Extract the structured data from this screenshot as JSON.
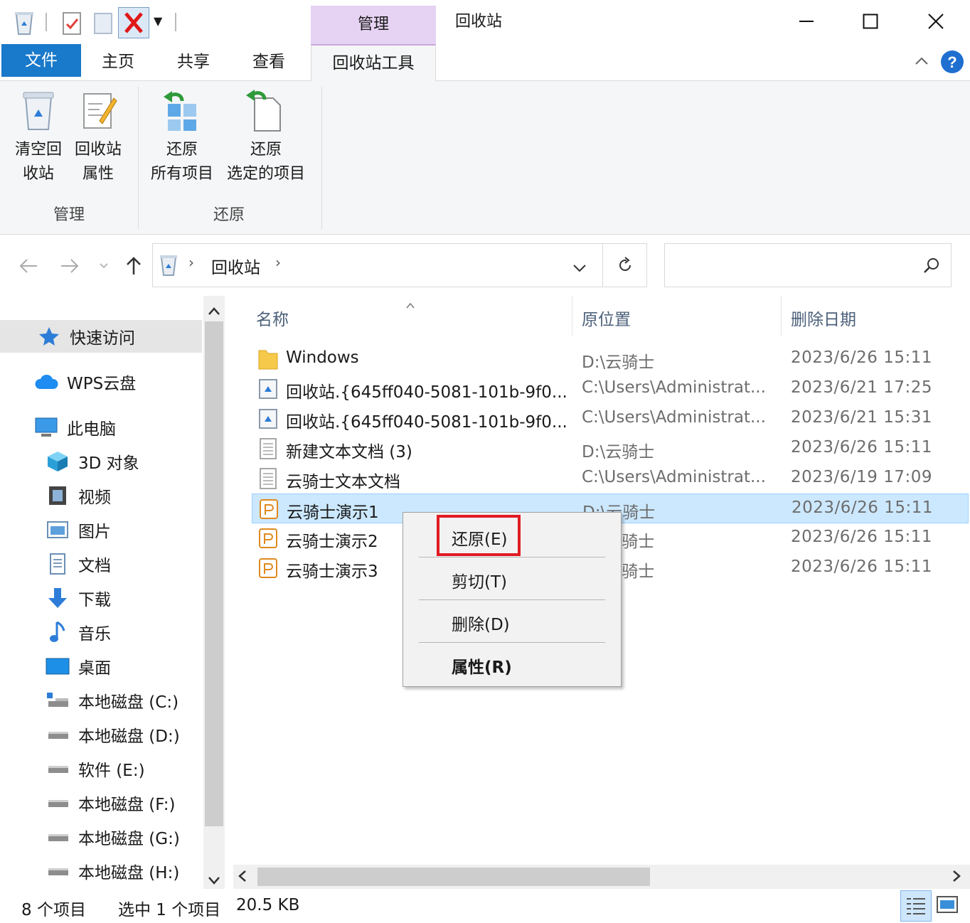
{
  "window": {
    "title": "回收站",
    "context_tab_header": "管理",
    "minimize_glyph": "—",
    "maximize_glyph": "☐",
    "close_glyph": "✕"
  },
  "ribbon_tabs": [
    "文件",
    "主页",
    "共享",
    "查看",
    "回收站工具"
  ],
  "ribbon": {
    "groups": [
      {
        "label": "管理",
        "buttons": [
          {
            "line1": "清空回",
            "line2": "收站",
            "icon": "empty-recycle-bin-icon"
          },
          {
            "line1": "回收站",
            "line2": "属性",
            "icon": "recycle-bin-properties-icon"
          }
        ]
      },
      {
        "label": "还原",
        "buttons": [
          {
            "line1": "还原",
            "line2": "所有项目",
            "icon": "restore-all-icon"
          },
          {
            "line1": "还原",
            "line2": "选定的项目",
            "icon": "restore-selected-icon"
          }
        ]
      }
    ]
  },
  "address": {
    "crumb": "回收站",
    "search_placeholder": ""
  },
  "nav": {
    "items": [
      {
        "label": "快速访问",
        "icon": "star-icon"
      },
      {
        "label": "WPS云盘",
        "icon": "cloud-icon"
      },
      {
        "label": "此电脑",
        "icon": "computer-icon"
      },
      {
        "label": "3D 对象",
        "icon": "3d-objects-icon"
      },
      {
        "label": "视频",
        "icon": "video-icon"
      },
      {
        "label": "图片",
        "icon": "pictures-icon"
      },
      {
        "label": "文档",
        "icon": "documents-icon"
      },
      {
        "label": "下载",
        "icon": "download-icon"
      },
      {
        "label": "音乐",
        "icon": "music-icon"
      },
      {
        "label": "桌面",
        "icon": "desktop-icon"
      },
      {
        "label": "本地磁盘 (C:)",
        "icon": "drive-c-icon"
      },
      {
        "label": "本地磁盘 (D:)",
        "icon": "drive-icon"
      },
      {
        "label": "软件 (E:)",
        "icon": "drive-icon"
      },
      {
        "label": "本地磁盘 (F:)",
        "icon": "drive-icon"
      },
      {
        "label": "本地磁盘 (G:)",
        "icon": "drive-icon"
      },
      {
        "label": "本地磁盘 (H:)",
        "icon": "drive-icon"
      }
    ]
  },
  "columns": {
    "name": "名称",
    "location": "原位置",
    "date": "删除日期"
  },
  "files": [
    {
      "name": "Windows",
      "location": "D:\\云骑士",
      "date": "2023/6/26 15:11",
      "icon": "folder-icon"
    },
    {
      "name": "回收站.{645ff040-5081-101b-9f0...",
      "location": "C:\\Users\\Administrat...",
      "date": "2023/6/21 17:25",
      "icon": "recycle-shortcut-icon"
    },
    {
      "name": "回收站.{645ff040-5081-101b-9f0...",
      "location": "C:\\Users\\Administrat...",
      "date": "2023/6/21 15:31",
      "icon": "recycle-shortcut-icon"
    },
    {
      "name": "新建文本文档 (3)",
      "location": "D:\\云骑士",
      "date": "2023/6/26 15:11",
      "icon": "text-file-icon"
    },
    {
      "name": "云骑士文本文档",
      "location": "C:\\Users\\Administrat...",
      "date": "2023/6/19 17:09",
      "icon": "text-file-icon"
    },
    {
      "name": "云骑士演示1",
      "location": "D:\\云骑士",
      "date": "2023/6/26 15:11",
      "icon": "presentation-file-icon"
    },
    {
      "name": "云骑士演示2",
      "location": "D:\\云骑士",
      "date": "2023/6/26 15:11",
      "icon": "presentation-file-icon"
    },
    {
      "name": "云骑士演示3",
      "location": "D:\\云骑士",
      "date": "2023/6/26 15:11",
      "icon": "presentation-file-icon"
    }
  ],
  "context_menu": {
    "restore": "还原(E)",
    "cut": "剪切(T)",
    "delete": "删除(D)",
    "properties": "属性(R)"
  },
  "status": {
    "item_count": "8 个项目",
    "selection": "选中 1 个项目",
    "size": "20.5 KB"
  },
  "colors": {
    "file_tab": "#1979ca",
    "context_tab": "#e6d2f2",
    "selection": "#cce8ff",
    "highlight_box": "#e11b22"
  }
}
